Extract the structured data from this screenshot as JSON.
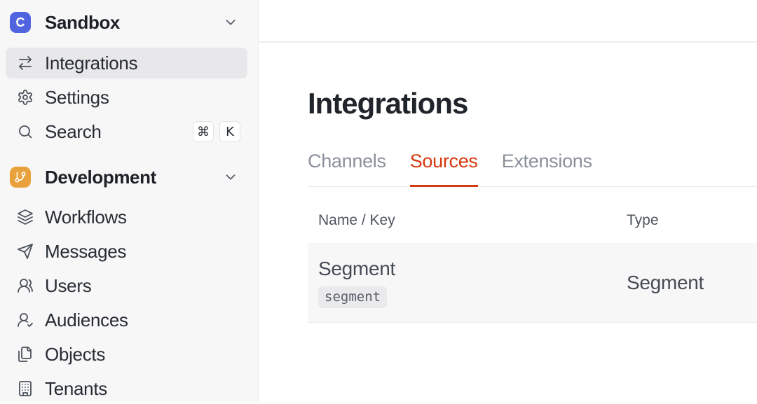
{
  "colors": {
    "accent": "#D5390E",
    "workspace_logo_bg": "#5063E0",
    "section_logo_bg": "#E9A23B",
    "sidebar_bg": "#F7F7F8",
    "selected_item_bg": "#E8E8EB",
    "row_bg": "#F7F7F8"
  },
  "sidebar": {
    "workspace": {
      "label": "Sandbox",
      "logo_letter": "C"
    },
    "items_top": [
      {
        "label": "Integrations"
      },
      {
        "label": "Settings"
      },
      {
        "label": "Search"
      }
    ],
    "search_shortcut": {
      "key1": "⌘",
      "key2": "K"
    },
    "section": {
      "label": "Development"
    },
    "items_bottom": [
      {
        "label": "Workflows"
      },
      {
        "label": "Messages"
      },
      {
        "label": "Users"
      },
      {
        "label": "Audiences"
      },
      {
        "label": "Objects"
      },
      {
        "label": "Tenants"
      }
    ]
  },
  "main": {
    "title": "Integrations",
    "tabs": [
      {
        "label": "Channels"
      },
      {
        "label": "Sources"
      },
      {
        "label": "Extensions"
      }
    ],
    "table": {
      "col_name": "Name / Key",
      "col_type": "Type",
      "rows": [
        {
          "name": "Segment",
          "key": "segment",
          "type": "Segment"
        }
      ]
    }
  }
}
